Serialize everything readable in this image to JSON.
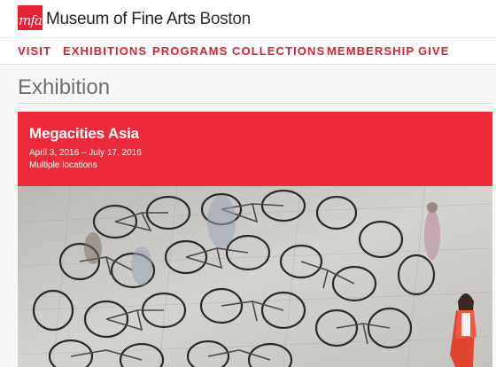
{
  "brand": {
    "logo_mark": "mfa",
    "name_bold": "Museum of Fine Arts",
    "name_light": "Boston",
    "accent": "#e8202f"
  },
  "nav": {
    "items": [
      {
        "label": "VISIT"
      },
      {
        "label": "EXHIBITIONS"
      },
      {
        "label": "PROGRAMS"
      },
      {
        "label": "COLLECTIONS"
      },
      {
        "label": "MEMBERSHIP"
      },
      {
        "label": "GIVE"
      }
    ]
  },
  "page": {
    "title": "Exhibition"
  },
  "exhibition": {
    "title": "Megacities Asia",
    "dates": "April 3, 2016 – July 17, 2016",
    "location": "Multiple locations",
    "banner_color": "#ee2a3a"
  }
}
